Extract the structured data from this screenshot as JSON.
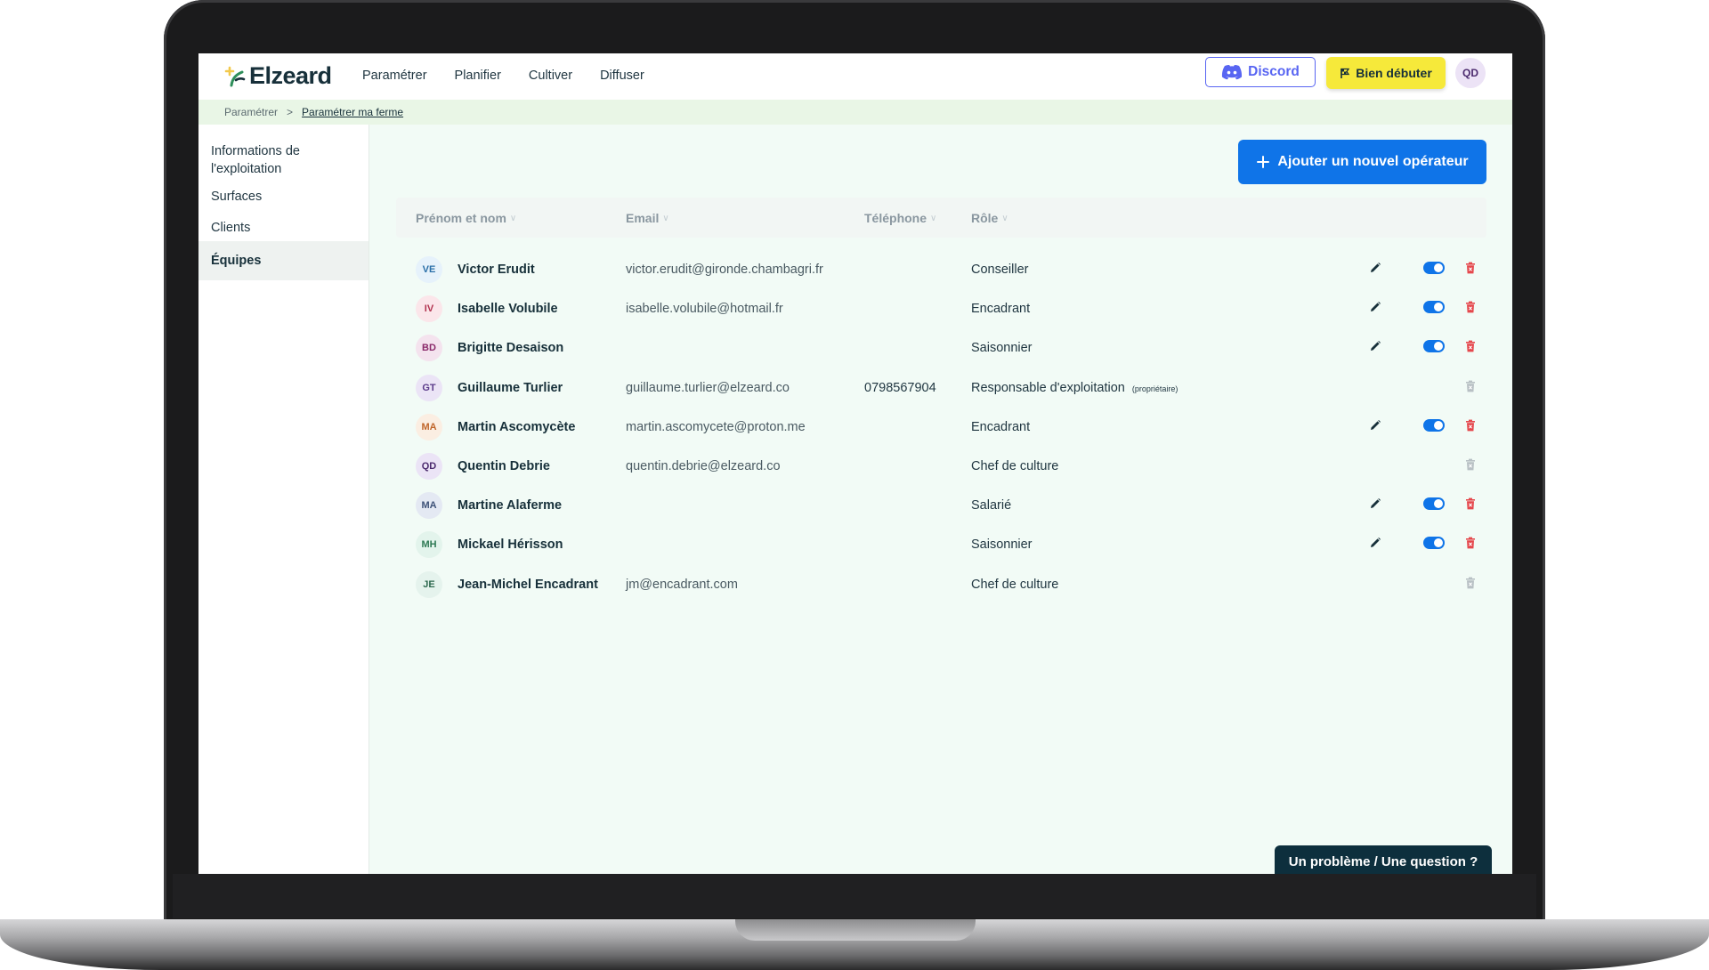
{
  "app": {
    "logo_text": "Elzeard",
    "nav": [
      "Paramétrer",
      "Planifier",
      "Cultiver",
      "Diffuser"
    ],
    "discord_label": "Discord",
    "start_label": "Bien débuter",
    "user_initials": "QD"
  },
  "breadcrumb": {
    "parent": "Paramétrer",
    "separator": ">",
    "current": "Paramétrer ma ferme"
  },
  "sidebar": {
    "items": [
      {
        "label": "Informations de l'exploitation",
        "active": false
      },
      {
        "label": "Surfaces",
        "active": false
      },
      {
        "label": "Clients",
        "active": false
      },
      {
        "label": "Équipes",
        "active": true
      }
    ]
  },
  "main": {
    "add_button_label": "Ajouter un nouvel opérateur",
    "columns": [
      "Prénom et nom",
      "Email",
      "Téléphone",
      "Rôle"
    ],
    "rows": [
      {
        "initials": "VE",
        "name": "Victor Erudit",
        "email": "victor.erudit@gironde.chambagri.fr",
        "phone": "",
        "role": "Conseiller",
        "owner_tag": "",
        "editable": true,
        "active": true,
        "avatar_bg": "#e6f2fb",
        "avatar_fg": "#2a6fa8"
      },
      {
        "initials": "IV",
        "name": "Isabelle Volubile",
        "email": "isabelle.volubile@hotmail.fr",
        "phone": "",
        "role": "Encadrant",
        "owner_tag": "",
        "editable": true,
        "active": true,
        "avatar_bg": "#fbe6ea",
        "avatar_fg": "#b2334f"
      },
      {
        "initials": "BD",
        "name": "Brigitte Desaison",
        "email": "",
        "phone": "",
        "role": "Saisonnier",
        "owner_tag": "",
        "editable": true,
        "active": true,
        "avatar_bg": "#f4e3ee",
        "avatar_fg": "#8a2a6a"
      },
      {
        "initials": "GT",
        "name": "Guillaume Turlier",
        "email": "guillaume.turlier@elzeard.co",
        "phone": "0798567904",
        "role": "Responsable d'exploitation",
        "owner_tag": "(propriétaire)",
        "editable": false,
        "active": false,
        "avatar_bg": "#ebe4f6",
        "avatar_fg": "#5b3b8a"
      },
      {
        "initials": "MA",
        "name": "Martin Ascomycète",
        "email": "martin.ascomycete@proton.me",
        "phone": "",
        "role": "Encadrant",
        "owner_tag": "",
        "editable": true,
        "active": true,
        "avatar_bg": "#fbeee2",
        "avatar_fg": "#c0652a"
      },
      {
        "initials": "QD",
        "name": "Quentin Debrie",
        "email": "quentin.debrie@elzeard.co",
        "phone": "",
        "role": "Chef de culture",
        "owner_tag": "",
        "editable": false,
        "active": false,
        "avatar_bg": "#ebe4f6",
        "avatar_fg": "#4b2a6e"
      },
      {
        "initials": "MA",
        "name": "Martine Alaferme",
        "email": "",
        "phone": "",
        "role": "Salarié",
        "owner_tag": "",
        "editable": true,
        "active": true,
        "avatar_bg": "#e4e9f3",
        "avatar_fg": "#3e5278"
      },
      {
        "initials": "MH",
        "name": "Mickael Hérisson",
        "email": "",
        "phone": "",
        "role": "Saisonnier",
        "owner_tag": "",
        "editable": true,
        "active": true,
        "avatar_bg": "#e3f4ec",
        "avatar_fg": "#2f7a55"
      },
      {
        "initials": "JE",
        "name": "Jean-Michel Encadrant",
        "email": "jm@encadrant.com",
        "phone": "",
        "role": "Chef de culture",
        "owner_tag": "",
        "editable": false,
        "active": false,
        "avatar_bg": "#e5f3ed",
        "avatar_fg": "#2f6a50"
      }
    ]
  },
  "help_label": "Un problème / Une question ?",
  "colors": {
    "accent_blue": "#0f74e8",
    "discord": "#5865f2",
    "start_yellow": "#f6e93a",
    "trash_active": "#e5484d",
    "trash_disabled": "#b8c0c4",
    "dark": "#0d2f3d"
  },
  "icons": {
    "edit": "pencil-icon",
    "delete": "trash-icon",
    "status": "toggle-switch",
    "add": "plus-icon",
    "start": "flag-icon",
    "discord": "discord-logo-icon",
    "sort": "chevron-down-icon"
  }
}
